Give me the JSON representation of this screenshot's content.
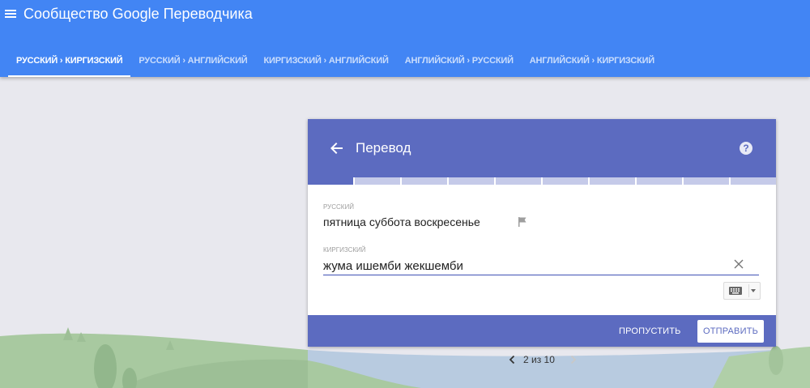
{
  "app": {
    "title": "Сообщество Google Переводчика"
  },
  "tabs": [
    {
      "label": "РУССКИЙ › КИРГИЗСКИЙ",
      "active": true
    },
    {
      "label": "РУССКИЙ › АНГЛИЙСКИЙ",
      "active": false
    },
    {
      "label": "КИРГИЗСКИЙ › АНГЛИЙСКИЙ",
      "active": false
    },
    {
      "label": "АНГЛИЙСКИЙ › РУССКИЙ",
      "active": false
    },
    {
      "label": "АНГЛИЙСКИЙ › КИРГИЗСКИЙ",
      "active": false
    }
  ],
  "card": {
    "title": "Перевод",
    "help_glyph": "?",
    "progress": {
      "completed": 1,
      "total": 10
    },
    "source": {
      "language": "РУССКИЙ",
      "text": "пятница суббота воскресенье"
    },
    "target": {
      "language": "КИРГИЗСКИЙ",
      "value": "жума ишемби жекшемби"
    },
    "skip_label": "ПРОПУСТИТЬ",
    "submit_label": "ОТПРАВИТЬ"
  },
  "pager": {
    "text": "2 из 10"
  },
  "colors": {
    "appbar": "#4285f4",
    "card_accent": "#5c6bc0",
    "progress_track": "#c5cae9",
    "background": "#e8e8ee"
  },
  "icons": [
    "menu-icon",
    "back-arrow-icon",
    "help-icon",
    "flag-icon",
    "clear-icon",
    "keyboard-icon",
    "dropdown-arrow-icon",
    "chevron-left-icon",
    "chevron-right-icon"
  ]
}
